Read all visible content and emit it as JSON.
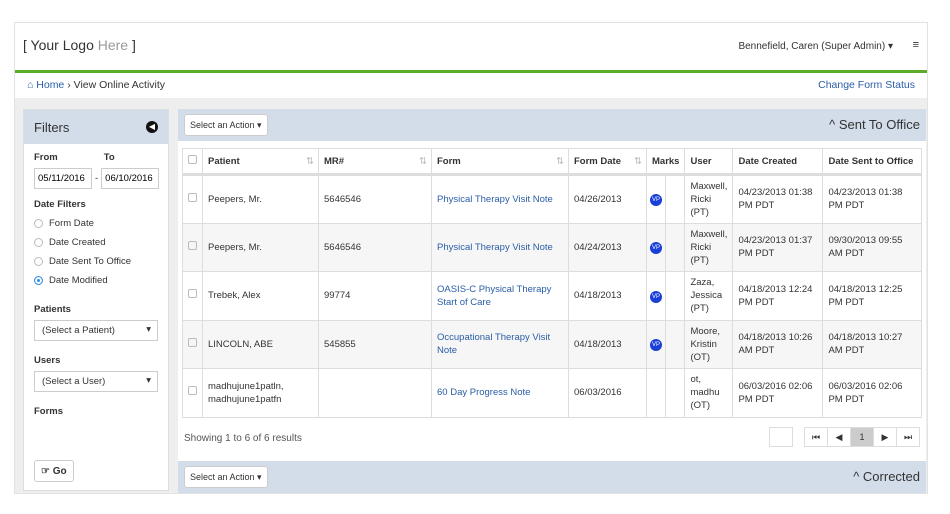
{
  "header": {
    "logo_main": "Your Logo",
    "logo_sub": "Here",
    "user": "Bennefield, Caren (Super Admin)"
  },
  "breadcrumb": {
    "home": "Home",
    "sep": "›",
    "current": "View Online Activity",
    "change_status": "Change Form Status"
  },
  "filters": {
    "title": "Filters",
    "from_label": "From",
    "to_label": "To",
    "from": "05/11/2016",
    "to": "06/10/2016",
    "date_filters_label": "Date Filters",
    "options": [
      "Form Date",
      "Date Created",
      "Date Sent To Office",
      "Date Modified"
    ],
    "selected": "Date Modified",
    "patients_label": "Patients",
    "patient_select": "(Select a Patient)",
    "users_label": "Users",
    "user_select": "(Select a User)",
    "forms_label": "Forms",
    "go": "Go"
  },
  "section1": {
    "action": "Select an Action",
    "title": "Sent To Office"
  },
  "table": {
    "columns": [
      "Patient",
      "MR#",
      "Form",
      "Form Date",
      "Marks",
      "User",
      "Date Created",
      "Date Sent to Office"
    ],
    "rows": [
      {
        "patient": "Peepers, Mr.",
        "mr": "5646546",
        "form": "Physical Therapy Visit Note",
        "form_date": "04/26/2013",
        "mark": "VP",
        "user": "Maxwell, Ricki (PT)",
        "created": "04/23/2013 01:38 PM PDT",
        "sent": "04/23/2013 01:38 PM PDT"
      },
      {
        "patient": "Peepers, Mr.",
        "mr": "5646546",
        "form": "Physical Therapy Visit Note",
        "form_date": "04/24/2013",
        "mark": "VP",
        "user": "Maxwell, Ricki (PT)",
        "created": "04/23/2013 01:37 PM PDT",
        "sent": "09/30/2013 09:55 AM PDT"
      },
      {
        "patient": "Trebek, Alex",
        "mr": "99774",
        "form": "OASIS-C Physical Therapy Start of Care",
        "form_date": "04/18/2013",
        "mark": "VP",
        "user": "Zaza, Jessica (PT)",
        "created": "04/18/2013 12:24 PM PDT",
        "sent": "04/18/2013 12:25 PM PDT"
      },
      {
        "patient": "LINCOLN, ABE",
        "mr": "545855",
        "form": "Occupational Therapy Visit Note",
        "form_date": "04/18/2013",
        "mark": "VP",
        "user": "Moore, Kristin (OT)",
        "created": "04/18/2013 10:26 AM PDT",
        "sent": "04/18/2013 10:27 AM PDT"
      },
      {
        "patient": "madhujune1patln, madhujune1patfn",
        "mr": "",
        "form": "60 Day Progress Note",
        "form_date": "06/03/2016",
        "mark": "",
        "user": "ot, madhu (OT)",
        "created": "06/03/2016 02:06 PM PDT",
        "sent": "06/03/2016 02:06 PM PDT"
      }
    ]
  },
  "pagination": {
    "summary": "Showing 1 to 6 of 6 results",
    "page": "1"
  },
  "section2": {
    "action": "Select an Action",
    "title": "Corrected"
  }
}
